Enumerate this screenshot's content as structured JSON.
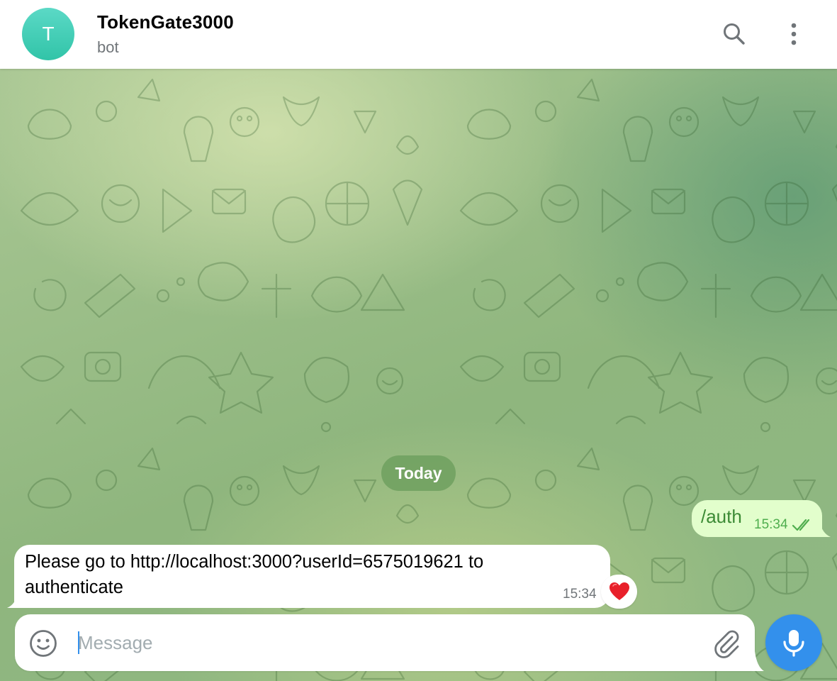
{
  "header": {
    "avatar_letter": "T",
    "title": "TokenGate3000",
    "subtitle": "bot",
    "icons": [
      "search-icon",
      "more-vertical-icon"
    ]
  },
  "chat": {
    "date_label": "Today",
    "messages": [
      {
        "direction": "outgoing",
        "text": "/auth",
        "time": "15:34",
        "status": "read"
      },
      {
        "direction": "incoming",
        "text": "Please go to http://localhost:3000?userId=6575019621 to authenticate",
        "time": "15:34",
        "reaction": "❤️"
      }
    ]
  },
  "composer": {
    "placeholder": "Message",
    "value": "",
    "icons": [
      "smile-icon",
      "paperclip-icon",
      "microphone-icon"
    ]
  },
  "colors": {
    "accent": "#3390ec",
    "avatar": "#3ccbb0",
    "outgoing_bubble": "#e2fecc",
    "outgoing_text": "#3b8a34"
  }
}
